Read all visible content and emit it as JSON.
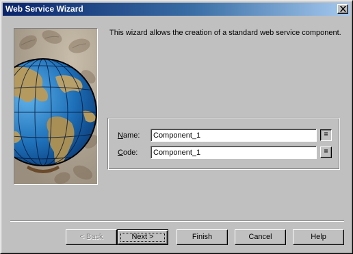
{
  "window": {
    "title": "Web Service Wizard"
  },
  "intro": "This wizard allows the creation of a standard web service component.",
  "fields": {
    "name": {
      "label_underlined": "N",
      "label_rest": "ame:",
      "value": "Component_1",
      "sync_label": "="
    },
    "code": {
      "label_underlined": "C",
      "label_rest": "ode:",
      "value": "Component_1",
      "sync_label": "="
    }
  },
  "buttons": {
    "back": "< Back",
    "next": "Next >",
    "finish": "Finish",
    "cancel": "Cancel",
    "help": "Help"
  },
  "colors": {
    "face": "#c0c0c0",
    "title_start": "#0a246a",
    "title_end": "#a6caf0",
    "ocean": "#1d6fb8",
    "land": "#b49a5e"
  }
}
